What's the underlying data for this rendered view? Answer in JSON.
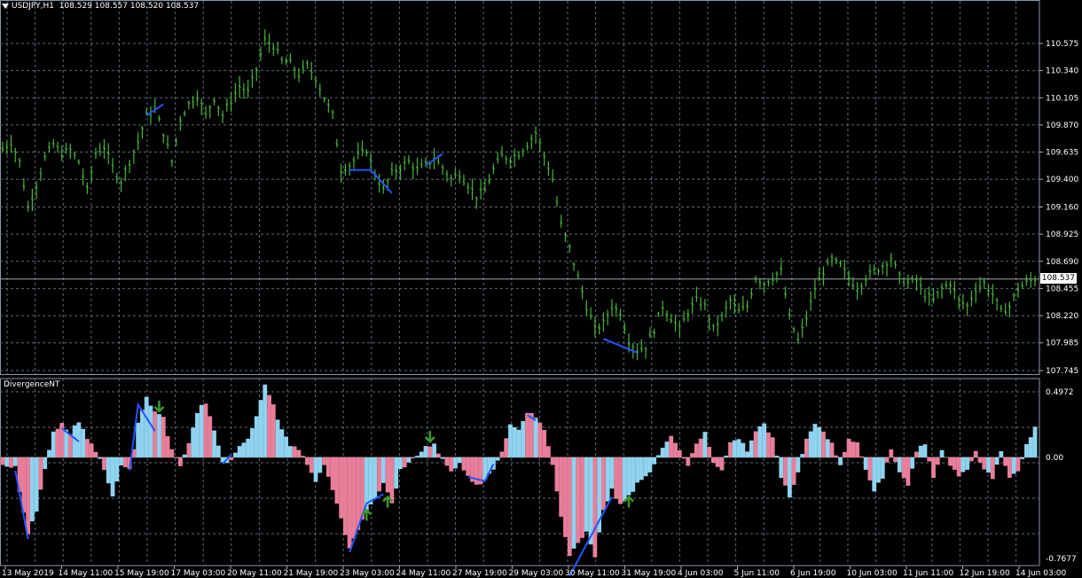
{
  "header": {
    "symbol": "USDJPY,H1",
    "ohlc": "108.529 108.557 108.520 108.537"
  },
  "indicator": {
    "name": "DivergenceNT"
  },
  "current_price": "108.537",
  "price_axis_labels": [
    "110.575",
    "110.340",
    "110.105",
    "109.870",
    "109.635",
    "109.400",
    "109.160",
    "108.925",
    "108.690",
    "108.455",
    "108.220",
    "107.985",
    "107.745"
  ],
  "indicator_axis_labels": [
    "0.4972",
    "0.00",
    "-0.7677"
  ],
  "time_labels": [
    "13 May 2019",
    "14 May 11:00",
    "15 May 19:00",
    "17 May 03:00",
    "20 May 11:00",
    "21 May 19:00",
    "23 May 03:00",
    "24 May 11:00",
    "27 May 19:00",
    "29 May 03:00",
    "30 May 11:00",
    "31 May 19:00",
    "4 Jun 03:00",
    "5 Jun 11:00",
    "6 Jun 19:00",
    "10 Jun 03:00",
    "11 Jun 11:00",
    "12 Jun 19:00",
    "14 Jun 03:00"
  ],
  "colors": {
    "background": "#000000",
    "grid": "#5a6a78",
    "bars": "#49b33a",
    "divergence_line": "#2255ff",
    "hist_pink": "#e87e9a",
    "hist_blue": "#8fd3f0",
    "arrow": "#3a9a2a"
  },
  "chart_data": [
    {
      "type": "line",
      "title": "USDJPY,H1",
      "price_range": [
        107.745,
        110.69
      ],
      "close_path": [
        [
          0,
          109.66
        ],
        [
          2,
          109.72
        ],
        [
          4,
          109.55
        ],
        [
          6,
          109.15
        ],
        [
          8,
          109.35
        ],
        [
          10,
          109.58
        ],
        [
          12,
          109.7
        ],
        [
          14,
          109.62
        ],
        [
          16,
          109.65
        ],
        [
          18,
          109.55
        ],
        [
          20,
          109.3
        ],
        [
          22,
          109.62
        ],
        [
          24,
          109.68
        ],
        [
          26,
          109.5
        ],
        [
          28,
          109.38
        ],
        [
          30,
          109.55
        ],
        [
          32,
          109.72
        ],
        [
          34,
          109.95
        ],
        [
          36,
          110.0
        ],
        [
          38,
          109.8
        ],
        [
          40,
          109.55
        ],
        [
          42,
          109.92
        ],
        [
          44,
          110.05
        ],
        [
          46,
          110.12
        ],
        [
          48,
          109.95
        ],
        [
          50,
          110.1
        ],
        [
          52,
          109.95
        ],
        [
          54,
          110.08
        ],
        [
          56,
          110.2
        ],
        [
          58,
          110.15
        ],
        [
          60,
          110.35
        ],
        [
          62,
          110.6
        ],
        [
          64,
          110.55
        ],
        [
          66,
          110.42
        ],
        [
          68,
          110.4
        ],
        [
          70,
          110.3
        ],
        [
          72,
          110.38
        ],
        [
          74,
          110.28
        ],
        [
          76,
          110.1
        ],
        [
          78,
          109.95
        ],
        [
          80,
          109.48
        ],
        [
          82,
          109.52
        ],
        [
          84,
          109.6
        ],
        [
          86,
          109.65
        ],
        [
          88,
          109.45
        ],
        [
          90,
          109.3
        ],
        [
          92,
          109.45
        ],
        [
          94,
          109.5
        ],
        [
          96,
          109.55
        ],
        [
          98,
          109.48
        ],
        [
          100,
          109.52
        ],
        [
          102,
          109.58
        ],
        [
          104,
          109.5
        ],
        [
          106,
          109.4
        ],
        [
          108,
          109.45
        ],
        [
          110,
          109.35
        ],
        [
          112,
          109.25
        ],
        [
          114,
          109.3
        ],
        [
          116,
          109.48
        ],
        [
          118,
          109.6
        ],
        [
          120,
          109.58
        ],
        [
          122,
          109.62
        ],
        [
          124,
          109.7
        ],
        [
          126,
          109.8
        ],
        [
          128,
          109.6
        ],
        [
          130,
          109.4
        ],
        [
          132,
          109.0
        ],
        [
          134,
          108.8
        ],
        [
          136,
          108.55
        ],
        [
          138,
          108.3
        ],
        [
          140,
          108.1
        ],
        [
          142,
          108.15
        ],
        [
          144,
          108.3
        ],
        [
          146,
          108.25
        ],
        [
          148,
          108.0
        ],
        [
          150,
          107.92
        ],
        [
          152,
          107.95
        ],
        [
          154,
          108.1
        ],
        [
          156,
          108.3
        ],
        [
          158,
          108.2
        ],
        [
          160,
          108.1
        ],
        [
          162,
          108.25
        ],
        [
          164,
          108.35
        ],
        [
          166,
          108.3
        ],
        [
          168,
          108.1
        ],
        [
          170,
          108.2
        ],
        [
          172,
          108.35
        ],
        [
          174,
          108.25
        ],
        [
          176,
          108.3
        ],
        [
          178,
          108.55
        ],
        [
          180,
          108.5
        ],
        [
          182,
          108.55
        ],
        [
          184,
          108.6
        ],
        [
          186,
          108.2
        ],
        [
          188,
          108.0
        ],
        [
          190,
          108.2
        ],
        [
          192,
          108.45
        ],
        [
          194,
          108.6
        ],
        [
          196,
          108.7
        ],
        [
          198,
          108.65
        ],
        [
          200,
          108.55
        ],
        [
          202,
          108.45
        ],
        [
          204,
          108.55
        ],
        [
          206,
          108.6
        ],
        [
          208,
          108.65
        ],
        [
          210,
          108.72
        ],
        [
          212,
          108.55
        ],
        [
          214,
          108.5
        ],
        [
          216,
          108.52
        ],
        [
          218,
          108.4
        ],
        [
          220,
          108.35
        ],
        [
          222,
          108.45
        ],
        [
          224,
          108.5
        ],
        [
          226,
          108.35
        ],
        [
          228,
          108.3
        ],
        [
          230,
          108.45
        ],
        [
          232,
          108.5
        ],
        [
          234,
          108.4
        ],
        [
          236,
          108.25
        ],
        [
          238,
          108.3
        ],
        [
          240,
          108.45
        ],
        [
          242,
          108.5
        ],
        [
          244,
          108.54
        ]
      ],
      "divergence_segments": [
        [
          [
            34,
            109.95
          ],
          [
            38,
            110.05
          ]
        ],
        [
          [
            82,
            109.48
          ],
          [
            87,
            109.48
          ],
          [
            92,
            109.28
          ]
        ],
        [
          [
            100,
            109.52
          ],
          [
            104,
            109.62
          ]
        ],
        [
          [
            142,
            108.02
          ],
          [
            150,
            107.9
          ]
        ]
      ]
    },
    {
      "type": "area",
      "title": "DivergenceNT",
      "ylim": [
        -0.7677,
        0.4972
      ],
      "histogram": [
        [
          0,
          -0.05
        ],
        [
          3,
          -0.08
        ],
        [
          6,
          -0.6
        ],
        [
          8,
          -0.4
        ],
        [
          10,
          -0.1
        ],
        [
          12,
          0.2
        ],
        [
          14,
          0.25
        ],
        [
          16,
          0.18
        ],
        [
          18,
          0.28
        ],
        [
          20,
          0.15
        ],
        [
          22,
          0.05
        ],
        [
          24,
          -0.1
        ],
        [
          26,
          -0.3
        ],
        [
          28,
          -0.05
        ],
        [
          30,
          -0.1
        ],
        [
          32,
          0.25
        ],
        [
          34,
          0.45
        ],
        [
          36,
          0.35
        ],
        [
          38,
          0.3
        ],
        [
          40,
          0.05
        ],
        [
          42,
          -0.08
        ],
        [
          44,
          0.1
        ],
        [
          46,
          0.35
        ],
        [
          48,
          0.42
        ],
        [
          50,
          0.2
        ],
        [
          52,
          -0.05
        ],
        [
          54,
          -0.02
        ],
        [
          56,
          0.1
        ],
        [
          58,
          0.15
        ],
        [
          60,
          0.3
        ],
        [
          62,
          0.55
        ],
        [
          64,
          0.4
        ],
        [
          66,
          0.2
        ],
        [
          68,
          0.1
        ],
        [
          70,
          0.05
        ],
        [
          72,
          -0.05
        ],
        [
          74,
          -0.2
        ],
        [
          76,
          -0.05
        ],
        [
          78,
          -0.25
        ],
        [
          80,
          -0.45
        ],
        [
          82,
          -0.7
        ],
        [
          84,
          -0.55
        ],
        [
          86,
          -0.4
        ],
        [
          88,
          -0.3
        ],
        [
          90,
          -0.2
        ],
        [
          92,
          -0.35
        ],
        [
          94,
          -0.1
        ],
        [
          96,
          -0.05
        ],
        [
          98,
          0.02
        ],
        [
          100,
          0.08
        ],
        [
          102,
          0.1
        ],
        [
          104,
          -0.02
        ],
        [
          106,
          -0.1
        ],
        [
          108,
          -0.05
        ],
        [
          110,
          -0.15
        ],
        [
          112,
          -0.2
        ],
        [
          114,
          -0.18
        ],
        [
          116,
          -0.08
        ],
        [
          118,
          0.05
        ],
        [
          120,
          0.25
        ],
        [
          122,
          0.22
        ],
        [
          124,
          0.35
        ],
        [
          126,
          0.3
        ],
        [
          128,
          0.2
        ],
        [
          130,
          -0.05
        ],
        [
          132,
          -0.45
        ],
        [
          134,
          -0.75
        ],
        [
          136,
          -0.65
        ],
        [
          138,
          -0.55
        ],
        [
          140,
          -0.75
        ],
        [
          142,
          -0.4
        ],
        [
          144,
          -0.25
        ],
        [
          146,
          -0.35
        ],
        [
          148,
          -0.3
        ],
        [
          150,
          -0.2
        ],
        [
          152,
          -0.15
        ],
        [
          154,
          -0.05
        ],
        [
          156,
          0.08
        ],
        [
          158,
          0.15
        ],
        [
          160,
          0.05
        ],
        [
          162,
          -0.05
        ],
        [
          164,
          0.1
        ],
        [
          166,
          0.2
        ],
        [
          168,
          -0.05
        ],
        [
          170,
          -0.1
        ],
        [
          172,
          0.1
        ],
        [
          174,
          0.15
        ],
        [
          176,
          0.05
        ],
        [
          178,
          0.2
        ],
        [
          180,
          0.25
        ],
        [
          182,
          0.15
        ],
        [
          184,
          -0.15
        ],
        [
          186,
          -0.3
        ],
        [
          188,
          -0.1
        ],
        [
          190,
          0.15
        ],
        [
          192,
          0.25
        ],
        [
          194,
          0.2
        ],
        [
          196,
          0.1
        ],
        [
          198,
          -0.05
        ],
        [
          200,
          0.15
        ],
        [
          202,
          0.1
        ],
        [
          204,
          -0.1
        ],
        [
          206,
          -0.25
        ],
        [
          208,
          -0.15
        ],
        [
          210,
          0.05
        ],
        [
          212,
          -0.1
        ],
        [
          214,
          -0.2
        ],
        [
          216,
          0.05
        ],
        [
          218,
          0.1
        ],
        [
          220,
          -0.15
        ],
        [
          222,
          0.05
        ],
        [
          224,
          -0.05
        ],
        [
          226,
          -0.15
        ],
        [
          228,
          -0.1
        ],
        [
          230,
          0.05
        ],
        [
          232,
          -0.1
        ],
        [
          234,
          -0.15
        ],
        [
          236,
          0.05
        ],
        [
          238,
          -0.15
        ],
        [
          240,
          -0.1
        ],
        [
          242,
          0.1
        ],
        [
          244,
          0.22
        ]
      ],
      "divergence_segments": [
        [
          [
            3,
            -0.1
          ],
          [
            6,
            -0.62
          ]
        ],
        [
          [
            14,
            0.22
          ],
          [
            18,
            0.12
          ]
        ],
        [
          [
            30,
            -0.1
          ],
          [
            32,
            0.4
          ],
          [
            36,
            0.2
          ]
        ],
        [
          [
            52,
            -0.05
          ],
          [
            54,
            0.02
          ]
        ],
        [
          [
            82,
            -0.72
          ],
          [
            86,
            -0.35
          ],
          [
            90,
            -0.28
          ]
        ],
        [
          [
            110,
            -0.15
          ],
          [
            114,
            -0.18
          ],
          [
            116,
            -0.05
          ]
        ],
        [
          [
            124,
            0.32
          ],
          [
            126,
            0.28
          ]
        ],
        [
          [
            134,
            -0.9
          ],
          [
            144,
            -0.3
          ]
        ]
      ],
      "arrows": [
        {
          "at": 37,
          "dir": "down",
          "value": 0.35
        },
        {
          "at": 101,
          "dir": "down",
          "value": 0.12
        },
        {
          "at": 86,
          "dir": "up",
          "value": -0.4
        },
        {
          "at": 91,
          "dir": "up",
          "value": -0.3
        },
        {
          "at": 148,
          "dir": "up",
          "value": -0.3
        }
      ]
    }
  ]
}
